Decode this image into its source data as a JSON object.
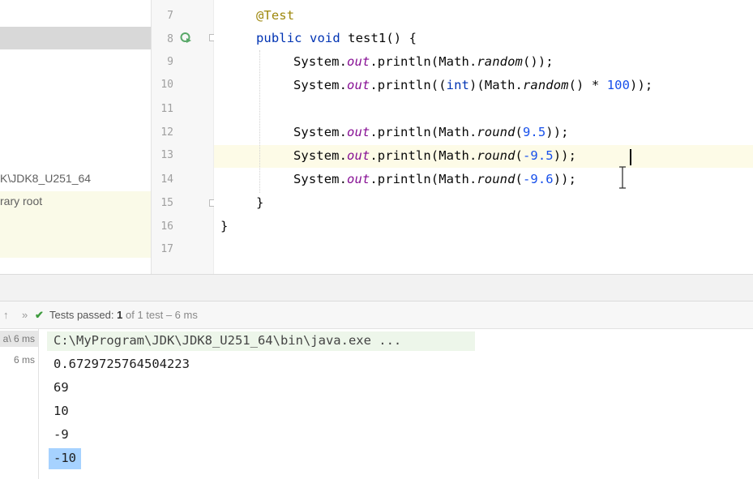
{
  "project": {
    "items": [
      {
        "label": "K\\JDK8_U251_64"
      },
      {
        "label": "rary root"
      }
    ]
  },
  "editor": {
    "lines": [
      {
        "num": "7"
      },
      {
        "num": "8"
      },
      {
        "num": "9"
      },
      {
        "num": "10"
      },
      {
        "num": "11"
      },
      {
        "num": "12"
      },
      {
        "num": "13"
      },
      {
        "num": "14"
      },
      {
        "num": "15"
      },
      {
        "num": "16"
      },
      {
        "num": "17"
      }
    ],
    "code": {
      "l7": "@Test",
      "l8_kw": "public void",
      "l8_rest": " test1() {",
      "l9": {
        "a": "System.",
        "b": "out",
        "c": ".println(Math.",
        "d": "random",
        "e": "());"
      },
      "l10": {
        "a": "System.",
        "b": "out",
        "c": ".println((",
        "kw": "int",
        "c2": ")(Math.",
        "d": "random",
        "e": "() * ",
        "n": "100",
        "f": "));"
      },
      "l12": {
        "a": "System.",
        "b": "out",
        "c": ".println(Math.",
        "d": "round",
        "e": "(",
        "n": "9.5",
        "f": "));"
      },
      "l13": {
        "a": "System.",
        "b": "out",
        "c": ".println(Math.",
        "d": "round",
        "e": "(",
        "n": "-9.5",
        "f": "));"
      },
      "l14": {
        "a": "System.",
        "b": "out",
        "c": ".println(Math.",
        "d": "round",
        "e": "(",
        "n": "-9.6",
        "f": "));"
      },
      "l15": "}",
      "l16": "}"
    }
  },
  "runbar": {
    "up_arrow": "↑",
    "more": "»",
    "check": "✔",
    "passed_label": "Tests passed:",
    "passed_count": "1",
    "of_text": "of 1 test – 6 ms"
  },
  "test_tree": {
    "items": [
      {
        "label": "a\\ 6 ms"
      },
      {
        "label": "6 ms"
      }
    ]
  },
  "console": {
    "lines": [
      "C:\\MyProgram\\JDK\\JDK8_U251_64\\bin\\java.exe ...",
      "0.6729725764504223",
      "69",
      "10",
      "-9",
      "-10"
    ]
  },
  "colors": {
    "keyword": "#0033b3",
    "annotation": "#9e880d",
    "field": "#871094",
    "number": "#1750eb",
    "pass": "#3e9b3e",
    "selection": "#a6d2ff"
  }
}
